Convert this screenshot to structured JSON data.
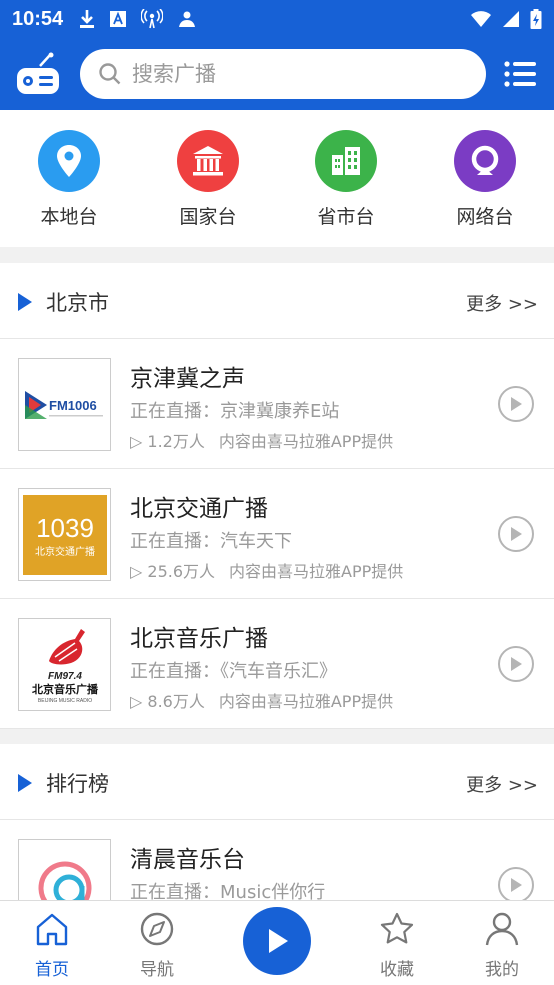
{
  "status_bar": {
    "time": "10:54"
  },
  "header": {
    "search_placeholder": "搜索广播",
    "brand_color": "#1761d6"
  },
  "categories": [
    {
      "label": "本地台",
      "icon": "location-pin-icon",
      "color": "#2a9cf0"
    },
    {
      "label": "国家台",
      "icon": "government-building-icon",
      "color": "#ef4040"
    },
    {
      "label": "省市台",
      "icon": "city-buildings-icon",
      "color": "#3cb34a"
    },
    {
      "label": "网络台",
      "icon": "network-ring-icon",
      "color": "#7b3cc4"
    }
  ],
  "beijing": {
    "title": "北京市",
    "more": "更多 >>",
    "items": [
      {
        "name": "京津冀之声",
        "live": "正在直播：京津冀康养E站",
        "listeners": "▷ 1.2万人",
        "source": "内容由喜马拉雅APP提供",
        "logo_text": "FM1006"
      },
      {
        "name": "北京交通广播",
        "live": "正在直播：汽车天下",
        "listeners": "▷ 25.6万人",
        "source": "内容由喜马拉雅APP提供",
        "logo_text": "1039",
        "logo_sub": "北京交通广播"
      },
      {
        "name": "北京音乐广播",
        "live": "正在直播：《汽车音乐汇》",
        "listeners": "▷ 8.6万人",
        "source": "内容由喜马拉雅APP提供",
        "logo_text": "FM97.4",
        "logo_sub": "北京音乐广播",
        "logo_en": "BEIJING MUSIC RADIO"
      }
    ]
  },
  "ranking": {
    "title": "排行榜",
    "more": "更多 >>",
    "items": [
      {
        "name": "清晨音乐台",
        "live": "正在直播：Music伴你行"
      }
    ]
  },
  "tabbar": {
    "tabs": [
      {
        "label": "首页",
        "icon": "home-icon",
        "active": true
      },
      {
        "label": "导航",
        "icon": "compass-icon",
        "active": false
      },
      {
        "label": "收藏",
        "icon": "star-icon",
        "active": false
      },
      {
        "label": "我的",
        "icon": "user-icon",
        "active": false
      }
    ]
  }
}
